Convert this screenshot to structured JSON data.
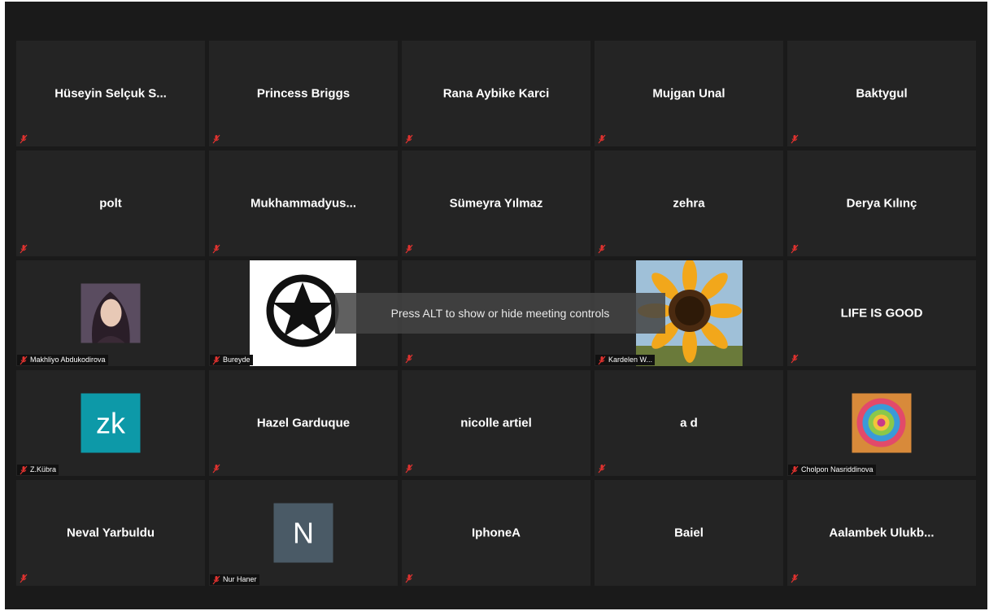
{
  "overlay_hint": "Press ALT to show or hide meeting controls",
  "row1": {
    "t1": "Hüseyin Selçuk S...",
    "t2": "Princess Briggs",
    "t3": "Rana Aybike Karci",
    "t4": "Mujgan Unal",
    "t5": "Baktygul"
  },
  "row2": {
    "t1": "polt",
    "t2": "Mukhammadyus...",
    "t3": "Sümeyra Yılmaz",
    "t4": "zehra",
    "t5": "Derya Kılınç"
  },
  "row3": {
    "t1_label": "Makhliyo Abdukodirova",
    "t2_label": "Bureyde",
    "t4_label": "Kardelen W...",
    "t5": "LIFE IS GOOD"
  },
  "row4": {
    "t1_initials": "zk",
    "t1_label": "Z.Kübra",
    "t2": "Hazel Garduque",
    "t3": "nicolle artiel",
    "t4": "a d",
    "t5_label": "Cholpon Nasriddinova"
  },
  "row5": {
    "t1": "Neval Yarbuldu",
    "t2_initial": "N",
    "t2_label": "Nur Haner",
    "t3": "IphoneA",
    "t4": "Baiel",
    "t5": "Aalambek  Ulukb..."
  },
  "colors": {
    "background": "#1a1a1a",
    "tile": "#242424",
    "mute_icon": "#e0322f",
    "zk_avatar": "#0d99a8",
    "n_avatar": "#4a5a66"
  }
}
